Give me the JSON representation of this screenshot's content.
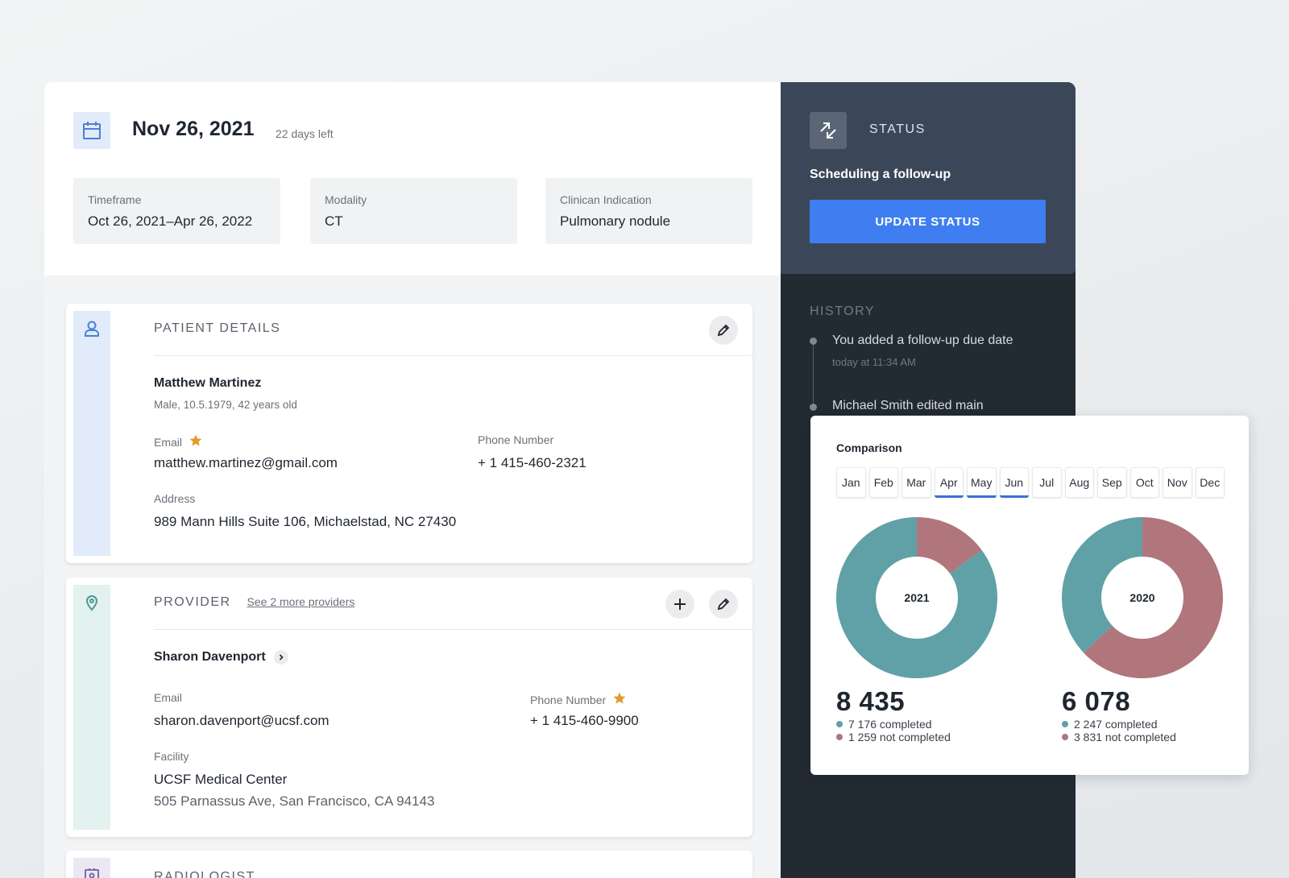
{
  "header": {
    "date": "Nov 26, 2021",
    "days_left": "22 days left",
    "timeframe": {
      "label": "Timeframe",
      "value": "Oct 26, 2021–Apr 26, 2022"
    },
    "modality": {
      "label": "Modality",
      "value": "CT"
    },
    "indication": {
      "label": "Clinican Indication",
      "value": "Pulmonary nodule"
    }
  },
  "patient": {
    "title": "PATIENT DETAILS",
    "name": "Matthew Martinez",
    "info": "Male, 10.5.1979, 42 years old",
    "email_label": "Email",
    "email": "matthew.martinez@gmail.com",
    "phone_label": "Phone Number",
    "phone": "+ 1 415-460-2321",
    "address_label": "Address",
    "address": "989 Mann Hills Suite 106, Michaelstad, NC 27430"
  },
  "provider": {
    "title": "PROVIDER",
    "more_link": "See 2 more providers",
    "name": "Sharon Davenport",
    "email_label": "Email",
    "email": "sharon.davenport@ucsf.com",
    "phone_label": "Phone Number",
    "phone": "+ 1 415-460-9900",
    "facility_label": "Facility",
    "facility": "UCSF Medical Center",
    "facility_address": "505 Parnassus Ave, San Francisco, CA 94143"
  },
  "radiologist": {
    "title": "RADIOLOGIST"
  },
  "status": {
    "label": "STATUS",
    "text": "Scheduling a follow-up",
    "button": "UPDATE STATUS"
  },
  "history": {
    "label": "HISTORY",
    "items": [
      {
        "text": "You added a follow-up due date",
        "time": "today at 11:34 AM"
      },
      {
        "text": "Michael Smith edited main"
      }
    ]
  },
  "comparison": {
    "title": "Comparison",
    "months": [
      "Jan",
      "Feb",
      "Mar",
      "Apr",
      "May",
      "Jun",
      "Jul",
      "Aug",
      "Sep",
      "Oct",
      "Nov",
      "Dec"
    ],
    "active_months": [
      "Apr",
      "May",
      "Jun"
    ]
  },
  "colors": {
    "completed": "#5fa1a6",
    "not_completed": "#b0767c",
    "accent": "#3f7ef0"
  },
  "chart_data": [
    {
      "type": "pie",
      "title": "2021",
      "total": "8 435",
      "categories": [
        "completed",
        "not completed"
      ],
      "values": [
        7176,
        1259
      ],
      "labels": [
        "7 176 completed",
        "1 259 not completed"
      ]
    },
    {
      "type": "pie",
      "title": "2020",
      "total": "6 078",
      "categories": [
        "completed",
        "not completed"
      ],
      "values": [
        2247,
        3831
      ],
      "labels": [
        "2 247 completed",
        "3 831 not completed"
      ]
    }
  ]
}
